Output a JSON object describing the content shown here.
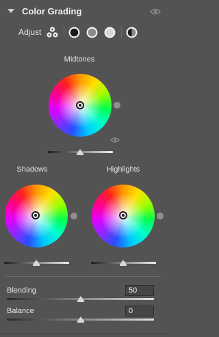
{
  "header": {
    "title": "Color Grading"
  },
  "adjust": {
    "label": "Adjust"
  },
  "wheels": {
    "midtones": {
      "label": "Midtones",
      "slider_value": 0.5
    },
    "shadows": {
      "label": "Shadows",
      "slider_value": 0.5
    },
    "highlights": {
      "label": "Highlights",
      "slider_value": 0.5
    }
  },
  "blending": {
    "label": "Blending",
    "value": "50",
    "slider_value": 0.5
  },
  "balance": {
    "label": "Balance",
    "value": "0",
    "slider_value": 0.5
  },
  "icons": {
    "collapse": "chevron-down-icon",
    "visibility": "eye-icon",
    "three_way": "three-way-view-icon",
    "shadows_view": "shadows-view-icon",
    "midtones_view": "midtones-view-icon",
    "highlights_view": "highlights-view-icon",
    "global_view": "global-view-icon"
  }
}
